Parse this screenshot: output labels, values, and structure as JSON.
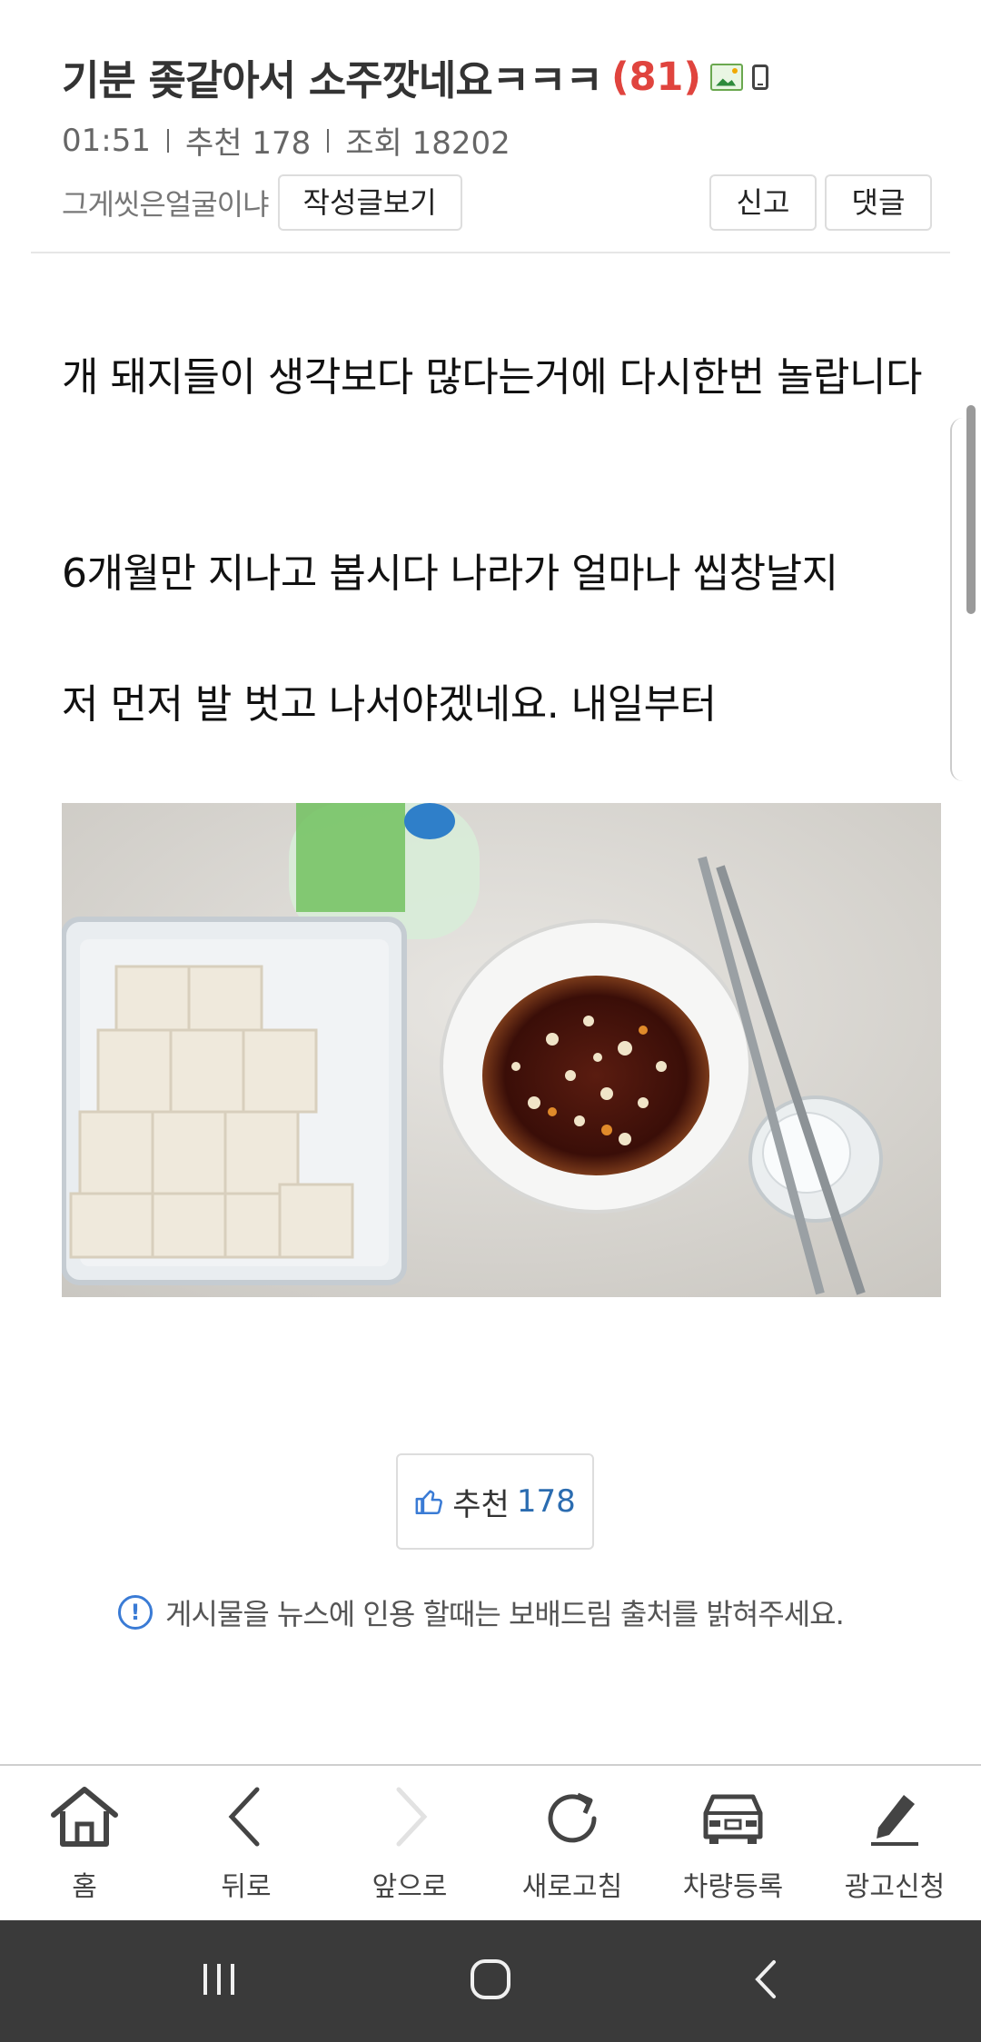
{
  "post": {
    "title": "기분 좆같아서 소주깟네요ㅋㅋㅋ",
    "comment_count": "(81)",
    "time": "01:51",
    "recommend": "추천 178",
    "views": "조회 18202",
    "author": "그게씻은얼굴이냐",
    "view_posts_button": "작성글보기",
    "report_button": "신고",
    "comment_button": "댓글"
  },
  "body": {
    "paragraphs": [
      "개 돼지들이 생각보다 많다는거에 다시한번 놀랍니다",
      "6개월만 지나고 봅시다 나라가 얼마나 씹창날지",
      "저 먼저 발 벗고 나서야겠네요. 내일부터"
    ]
  },
  "recommend_box": {
    "label": "추천",
    "count": "178"
  },
  "notice": "게시물을 뉴스에 인용 할때는 보배드림 출처를 밝혀주세요.",
  "bottom_nav": {
    "items": [
      {
        "label": "홈",
        "icon": "home-icon"
      },
      {
        "label": "뒤로",
        "icon": "back-icon"
      },
      {
        "label": "앞으로",
        "icon": "forward-icon"
      },
      {
        "label": "새로고침",
        "icon": "refresh-icon"
      },
      {
        "label": "차량등록",
        "icon": "car-icon"
      },
      {
        "label": "광고신청",
        "icon": "pen-icon"
      }
    ]
  },
  "colors": {
    "comment_count": "#e0443e",
    "recommend_count": "#2b6cb0",
    "notice_icon": "#3a7bd5",
    "system_bar": "#3a3a3a"
  }
}
